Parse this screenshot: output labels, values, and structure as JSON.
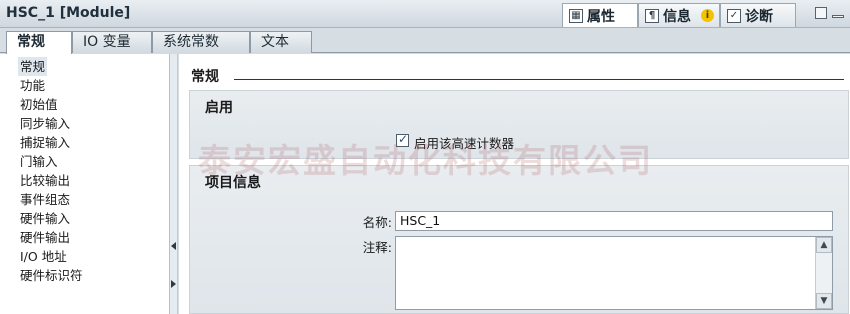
{
  "window": {
    "title": "HSC_1 [Module]"
  },
  "inspector_tabs": [
    {
      "label": "属性",
      "icon": "properties-icon"
    },
    {
      "label": "信息",
      "icon": "info-icon",
      "badge": "i"
    },
    {
      "label": "诊断",
      "icon": "diagnostics-icon"
    }
  ],
  "sub_tabs": [
    "常规",
    "IO 变量",
    "系统常数",
    "文本"
  ],
  "nav": {
    "items": [
      "常规",
      "功能",
      "初始值",
      "同步输入",
      "捕捉输入",
      "门输入",
      "比较输出",
      "事件组态",
      "硬件输入",
      "硬件输出",
      "I/O 地址",
      "硬件标识符"
    ],
    "selected_index": 0
  },
  "content": {
    "section_title": "常规",
    "enable_group": {
      "title": "启用",
      "checkbox_label": "启用该高速计数器",
      "checked": true
    },
    "project_group": {
      "title": "项目信息",
      "name_label": "名称:",
      "name_value": "HSC_1",
      "comment_label": "注释:",
      "comment_value": ""
    }
  },
  "watermark": "泰安宏盛自动化科技有限公司",
  "colors": {
    "background": "#d4dce2",
    "group_bg": "#e6eaee",
    "accent": "#2a4d7a"
  }
}
